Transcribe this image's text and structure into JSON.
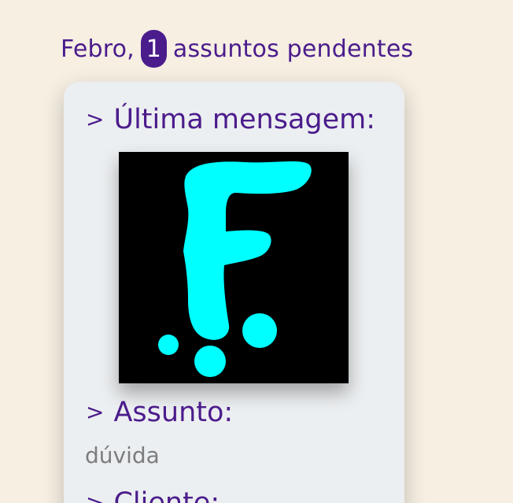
{
  "greeting": {
    "name": "Febro,",
    "pending_count": "1",
    "pending_text": "assuntos pendentes"
  },
  "card": {
    "last_message_label": "Última mensagem:",
    "subject_label": "Assunto:",
    "subject_value": "dúvida",
    "client_label": "Cliente:",
    "chevron": ">"
  },
  "logo": {
    "icon": "f-brand-logo-icon",
    "background_color": "#000000",
    "glyph_color": "#00ffff"
  },
  "colors": {
    "accent": "#4b1c8c",
    "page_background": "#f6efe2",
    "card_background": "#eceff1",
    "muted_text": "#7d7d7d"
  }
}
